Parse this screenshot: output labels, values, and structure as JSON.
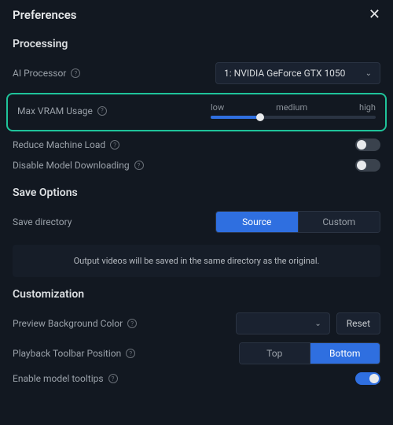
{
  "title": "Preferences",
  "sections": {
    "processing": {
      "title": "Processing",
      "ai_processor_label": "AI Processor",
      "ai_processor_value": "1: NVIDIA GeForce GTX 1050",
      "vram_label": "Max VRAM Usage",
      "vram_low": "low",
      "vram_medium": "medium",
      "vram_high": "high",
      "reduce_load_label": "Reduce Machine Load",
      "disable_download_label": "Disable Model Downloading"
    },
    "save": {
      "title": "Save Options",
      "save_dir_label": "Save directory",
      "source_btn": "Source",
      "custom_btn": "Custom",
      "info": "Output videos will be saved in the same directory as the original."
    },
    "custom": {
      "title": "Customization",
      "preview_bg_label": "Preview Background Color",
      "reset_btn": "Reset",
      "toolbar_pos_label": "Playback Toolbar Position",
      "top_btn": "Top",
      "bottom_btn": "Bottom",
      "tooltips_label": "Enable model tooltips"
    }
  }
}
